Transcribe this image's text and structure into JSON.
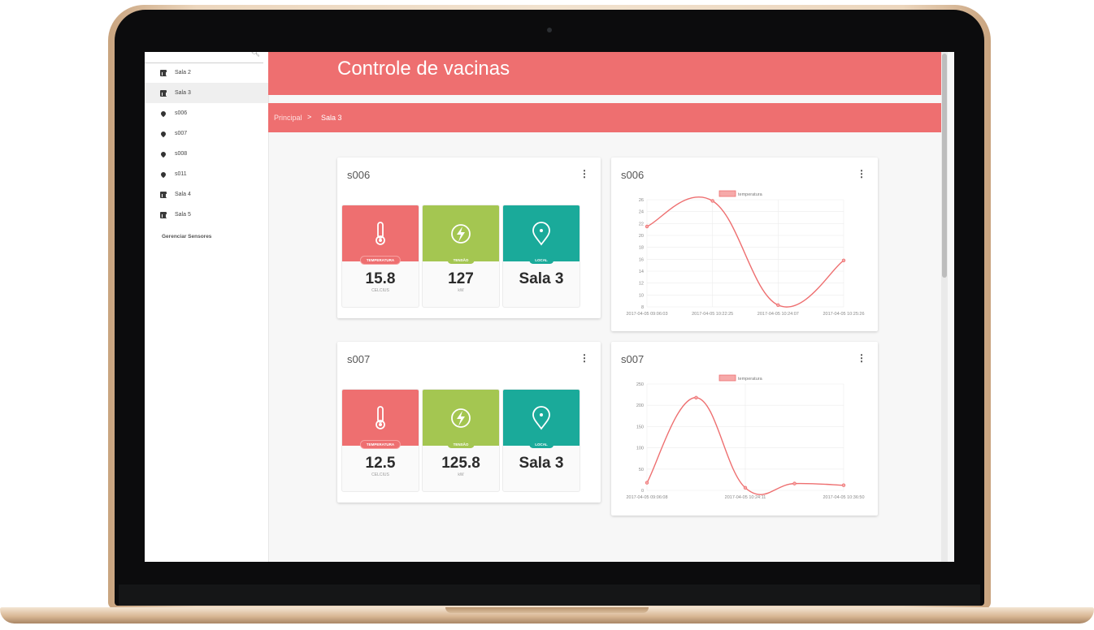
{
  "app": {
    "title": "Controle de vacinas"
  },
  "breadcrumb": {
    "root": "Principal",
    "separator": ">",
    "current": "Sala 3"
  },
  "sidebar": {
    "items": [
      {
        "label": "Sala 2",
        "icon": "chart-icon",
        "active": false
      },
      {
        "label": "Sala 3",
        "icon": "chart-icon",
        "active": true
      },
      {
        "label": "s006",
        "icon": "pin-icon",
        "active": false
      },
      {
        "label": "s007",
        "icon": "pin-icon",
        "active": false
      },
      {
        "label": "s008",
        "icon": "pin-icon",
        "active": false
      },
      {
        "label": "s011",
        "icon": "pin-icon",
        "active": false
      },
      {
        "label": "Sala 4",
        "icon": "chart-icon",
        "active": false
      },
      {
        "label": "Sala 5",
        "icon": "chart-icon",
        "active": false
      }
    ],
    "manage_label": "Gerenciar Sensores"
  },
  "colors": {
    "accent": "#ee6f70",
    "temp": "#ee6f70",
    "voltage": "#a4c651",
    "location": "#1aaa9a",
    "line": "#ee6f70"
  },
  "sensors": [
    {
      "name": "s006",
      "tiles": [
        {
          "badge": "TEMPERATURA",
          "value": "15.8",
          "unit": "CELCIUS",
          "icon": "thermometer-icon"
        },
        {
          "badge": "TENSÃO",
          "value": "127",
          "unit": "kW",
          "icon": "lightning-icon"
        },
        {
          "badge": "LOCAL",
          "value": "Sala 3",
          "unit": "",
          "icon": "location-pin-icon"
        }
      ]
    },
    {
      "name": "s007",
      "tiles": [
        {
          "badge": "TEMPERATURA",
          "value": "12.5",
          "unit": "CELCIUS",
          "icon": "thermometer-icon"
        },
        {
          "badge": "TENSÃO",
          "value": "125.8",
          "unit": "kW",
          "icon": "lightning-icon"
        },
        {
          "badge": "LOCAL",
          "value": "Sala 3",
          "unit": "",
          "icon": "location-pin-icon"
        }
      ]
    }
  ],
  "chart_data": [
    {
      "type": "line",
      "title": "s006",
      "legend": "temperatura",
      "legend_position": "top",
      "grid": true,
      "ylim": [
        8,
        26
      ],
      "yticks": [
        8,
        10,
        12,
        14,
        16,
        18,
        20,
        22,
        24,
        26
      ],
      "x_tick_labels": [
        "2017-04-05 09:06:03",
        "2017-04-05 10:22:25",
        "2017-04-05 10:24:07",
        "2017-04-05 10:25:26"
      ],
      "series": [
        {
          "name": "temperatura",
          "x": [
            0,
            1,
            2,
            3
          ],
          "values": [
            21.5,
            25.8,
            8.3,
            15.8
          ]
        }
      ]
    },
    {
      "type": "line",
      "title": "s007",
      "legend": "temperatura",
      "legend_position": "top",
      "grid": true,
      "ylim": [
        0,
        250
      ],
      "yticks": [
        0,
        50,
        100,
        150,
        200,
        250
      ],
      "x_tick_labels": [
        "2017-04-05 09:06:08",
        "2017-04-05 10:24:11",
        "2017-04-05 10:36:50"
      ],
      "series": [
        {
          "name": "temperatura",
          "x": [
            0,
            0.5,
            1,
            1.5,
            2
          ],
          "values": [
            18,
            218,
            6,
            16,
            12
          ]
        }
      ]
    }
  ]
}
